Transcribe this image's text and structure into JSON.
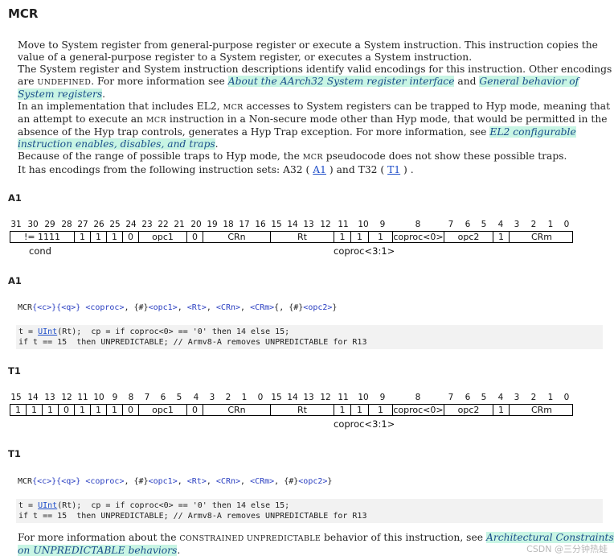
{
  "title": "MCR",
  "intro": {
    "p1_l1": "Move to System register from general-purpose register or execute a System instruction. This instruction copies the",
    "p1_l2": "value of a general-purpose register to a System register, or executes a System instruction.",
    "p2_l1": "The System register and System instruction descriptions identify valid encodings for this instruction. Other encodings",
    "p2_l2_a": "are ",
    "p2_l2_undef": "UNDEFINED",
    "p2_l2_b": ". For more information see ",
    "p2_link1": "About the AArch32 System register interface",
    "p2_l2_and": " and ",
    "p2_link2": "General behavior of",
    "p2_link2b": "System registers",
    "p2_end": ".",
    "p3_l1_a": "In an implementation that includes EL2, ",
    "p3_mcr1": "MCR",
    "p3_l1_b": " accesses to System registers can be trapped to Hyp mode, meaning that",
    "p3_l2_a": "an attempt to execute an ",
    "p3_mcr2": "MCR",
    "p3_l2_b": " instruction in a Non-secure mode other than Hyp mode, that would be permitted in the",
    "p3_l3_a": "absence of the Hyp trap controls, generates a Hyp Trap exception. For more information, see ",
    "p3_link": "EL2 configurable",
    "p3_linkb": "instruction enables, disables, and traps",
    "p3_end": ".",
    "p4_a": "Because of the range of possible traps to Hyp mode, the ",
    "p4_mcr": "MCR",
    "p4_b": " pseudocode does not show these possible traps.",
    "p5_a": "It has encodings from the following instruction sets: A32 ( ",
    "p5_a1": "A1",
    "p5_b": " ) and T32 ( ",
    "p5_t1": "T1",
    "p5_c": " ) ."
  },
  "a1": {
    "heading": "A1",
    "bits": [
      "31",
      "30",
      "29",
      "28",
      "27",
      "26",
      "25",
      "24",
      "23",
      "22",
      "21",
      "20",
      "19",
      "18",
      "17",
      "16",
      "15",
      "14",
      "13",
      "12",
      "11",
      "10",
      "9",
      "8",
      "7",
      "6",
      "5",
      "4",
      "3",
      "2",
      "1",
      "0"
    ],
    "fields": [
      "!= 1111",
      "1",
      "1",
      "1",
      "0",
      "opc1",
      "0",
      "CRn",
      "Rt",
      "1",
      "1",
      "1",
      "coproc<0>",
      "opc2",
      "1",
      "CRm"
    ],
    "label_cond": "cond",
    "label_coproc": "coproc<3:1>",
    "heading2": "A1",
    "asm": {
      "m": "MCR",
      "c": "{<c>}",
      "q": "{<q>}",
      "coproc": "<coproc>",
      "sep1": ", {#}",
      "opc1": "<opc1>",
      "sep2": ", ",
      "rt": "<Rt>",
      "sep3": ", ",
      "crn": "<CRn>",
      "sep4": ", ",
      "crm": "<CRm>",
      "sep5": "{, {#}",
      "opc2": "<opc2>",
      "sep6": "}"
    },
    "dec1_a": "t = ",
    "dec1_uint": "UInt",
    "dec1_b": "(Rt);  cp = if coproc<0> == '0' then 14 else 15;",
    "dec2": "if t == 15  then UNPREDICTABLE; // Armv8-A removes UNPREDICTABLE for R13"
  },
  "t1": {
    "heading": "T1",
    "bits": [
      "15",
      "14",
      "13",
      "12",
      "11",
      "10",
      "9",
      "8",
      "7",
      "6",
      "5",
      "4",
      "3",
      "2",
      "1",
      "0",
      "15",
      "14",
      "13",
      "12",
      "11",
      "10",
      "9",
      "8",
      "7",
      "6",
      "5",
      "4",
      "3",
      "2",
      "1",
      "0"
    ],
    "fields": [
      "1",
      "1",
      "1",
      "0",
      "1",
      "1",
      "1",
      "0",
      "opc1",
      "0",
      "CRn",
      "Rt",
      "1",
      "1",
      "1",
      "coproc<0>",
      "opc2",
      "1",
      "CRm"
    ],
    "label_coproc": "coproc<3:1>",
    "heading2": "T1",
    "asm": {
      "m": "MCR",
      "c": "{<c>}",
      "q": "{<q>}",
      "coproc": "<coproc>",
      "sep1": ", {#}",
      "opc1": "<opc1>",
      "sep2": ", ",
      "rt": "<Rt>",
      "sep3": ", ",
      "crn": "<CRn>",
      "sep4": ", ",
      "crm": "<CRm>",
      "sep5": ", {#}",
      "opc2": "<opc2>",
      "sep6": "}"
    },
    "dec1_a": "t = ",
    "dec1_uint": "UInt",
    "dec1_b": "(Rt);  cp = if coproc<0> == '0' then 14 else 15;",
    "dec2": "if t == 15  then UNPREDICTABLE; // Armv8-A removes UNPREDICTABLE for R13"
  },
  "footer": {
    "a": "For more information about the ",
    "constrained": "CONSTRAINED UNPREDICTABLE",
    "b": " behavior of this instruction, see ",
    "link": "Architectural Constraints",
    "linkb": "on UNPREDICTABLE behaviors",
    "end": "."
  },
  "watermark": "CSDN @三分钟热蛙"
}
